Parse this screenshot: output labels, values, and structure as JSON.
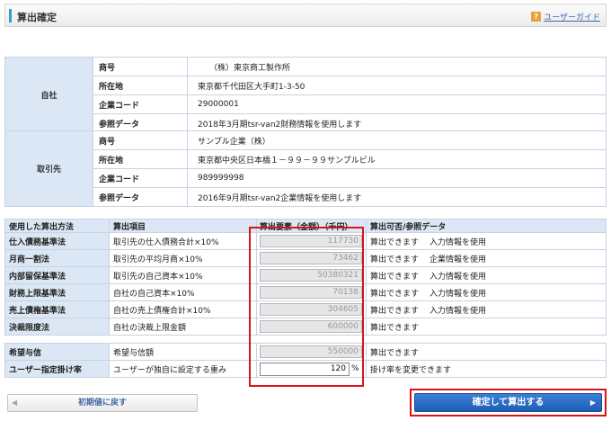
{
  "header": {
    "title": "算出確定",
    "guide_icon": "question-icon",
    "guide_label": "ユーザーガイド"
  },
  "company_self": {
    "section": "自社",
    "rows": [
      {
        "label": "商号",
        "value": "（株）東京商工製作所"
      },
      {
        "label": "所在地",
        "value": "東京都千代田区大手町1-3-50"
      },
      {
        "label": "企業コード",
        "value": "29000001"
      },
      {
        "label": "参照データ",
        "value": "2018年3月期tsr-van2財務情報を使用します"
      }
    ]
  },
  "company_partner": {
    "section": "取引先",
    "rows": [
      {
        "label": "商号",
        "value": "サンプル企業（株）"
      },
      {
        "label": "所在地",
        "value": "東京都中央区日本橋１－９９－９９サンプルビル"
      },
      {
        "label": "企業コード",
        "value": "989999998"
      },
      {
        "label": "参照データ",
        "value": "2016年9月期tsr-van2企業情報を使用します"
      }
    ]
  },
  "calc": {
    "headers": {
      "method": "使用した算出方法",
      "item": "算出項目",
      "amount": "算出要素（金額）（千円）",
      "status": "算出可否/参照データ"
    },
    "rows": [
      {
        "method": "仕入債務基準法",
        "item": "取引先の仕入債務合計×10%",
        "amount": "117730",
        "status": "算出できます",
        "ref": "入力情報を使用"
      },
      {
        "method": "月商一割法",
        "item": "取引先の平均月商×10%",
        "amount": "73462",
        "status": "算出できます",
        "ref": "企業情報を使用"
      },
      {
        "method": "内部留保基準法",
        "item": "取引先の自己資本×10%",
        "amount": "50380321",
        "status": "算出できます",
        "ref": "入力情報を使用"
      },
      {
        "method": "財務上限基準法",
        "item": "自社の自己資本×10%",
        "amount": "70138",
        "status": "算出できます",
        "ref": "入力情報を使用"
      },
      {
        "method": "売上債権基準法",
        "item": "自社の売上債権合計×10%",
        "amount": "304605",
        "status": "算出できます",
        "ref": "入力情報を使用"
      },
      {
        "method": "決裁限度法",
        "item": "自社の決裁上限金額",
        "amount": "600000",
        "status": "算出できます",
        "ref": ""
      }
    ],
    "extra_rows": [
      {
        "method": "希望与信",
        "item": "希望与信額",
        "amount": "550000",
        "status": "算出できます"
      },
      {
        "method": "ユーザー指定掛け率",
        "item": "ユーザーが独自に設定する重み",
        "amount": "120",
        "unit": "%",
        "status": "掛け率を変更できます"
      }
    ]
  },
  "buttons": {
    "reset_label": "初期値に戻す",
    "confirm_label": "確定して算出する"
  },
  "colors": {
    "accent": "#2aa6c9",
    "header_cell": "#dbe7f4",
    "highlight": "#d8131a",
    "confirm_button": "#2a6cc7"
  }
}
